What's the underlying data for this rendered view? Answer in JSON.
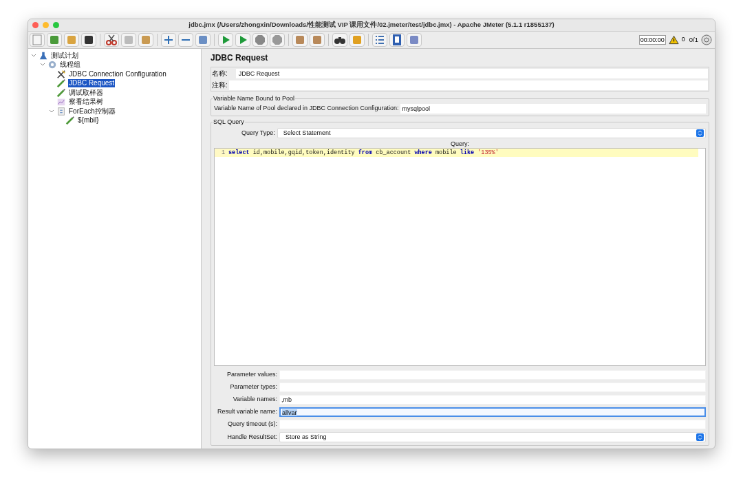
{
  "window": {
    "title": "jdbc.jmx (/Users/zhongxin/Downloads/性能测试 VIP 课用文件/02.jmeter/test/jdbc.jmx) - Apache JMeter (5.1.1 r1855137)"
  },
  "status": {
    "timer": "00:00:00",
    "warnings": "0",
    "threads": "0/1"
  },
  "tree": [
    {
      "label": "测试计划",
      "kind": "plan",
      "selected": false,
      "expanded": true,
      "children": [
        {
          "label": "线程组",
          "kind": "group",
          "selected": false,
          "expanded": true,
          "children": [
            {
              "label": "JDBC Connection Configuration",
              "kind": "config",
              "selected": false
            },
            {
              "label": "JDBC Request",
              "kind": "sampler",
              "selected": true
            },
            {
              "label": "调试取样器",
              "kind": "sampler",
              "selected": false
            },
            {
              "label": "察看结果树",
              "kind": "listener",
              "selected": false
            },
            {
              "label": "ForEach控制器",
              "kind": "controller",
              "selected": false,
              "expanded": true,
              "children": [
                {
                  "label": "${mbil}",
                  "kind": "sampler",
                  "selected": false
                }
              ]
            }
          ]
        }
      ]
    }
  ],
  "panel": {
    "title": "JDBC Request",
    "name_label": "名称:",
    "name_value": "JDBC Request",
    "comment_label": "注释:",
    "pool_group": {
      "title": "Variable Name Bound to Pool",
      "label": "Variable Name of Pool declared in JDBC Connection Configuration:",
      "value": "mysqlpool"
    },
    "sql_group": {
      "title": "SQL Query",
      "query_type_label": "Query Type:",
      "query_type": "Select Statement",
      "query_label": "Query:",
      "lines": [
        {
          "number": "1",
          "tokens": [
            {
              "kind": "keyword",
              "text": "select"
            },
            {
              "kind": "plain",
              "text": " id,mobile,gqid,token,identity "
            },
            {
              "kind": "keyword",
              "text": "from"
            },
            {
              "kind": "plain",
              "text": " cb_account "
            },
            {
              "kind": "keyword",
              "text": "where"
            },
            {
              "kind": "plain",
              "text": " mobile "
            },
            {
              "kind": "keyword",
              "text": "like"
            },
            {
              "kind": "string",
              "text": "'135%'"
            }
          ]
        }
      ]
    },
    "fields": [
      {
        "label": "Parameter values:",
        "kind": "text",
        "focused": false
      },
      {
        "label": "Parameter types:",
        "kind": "text",
        "focused": false
      },
      {
        "label": "Variable names:",
        "kind": "text",
        "value": ",mb",
        "focused": false
      },
      {
        "label": "Result variable name:",
        "kind": "text",
        "value": "allvar",
        "focused": true
      },
      {
        "label": "Query timeout (s):",
        "kind": "text",
        "focused": false
      },
      {
        "label": "Handle ResultSet:",
        "kind": "select",
        "value": "Store as String",
        "focused": false
      }
    ]
  }
}
